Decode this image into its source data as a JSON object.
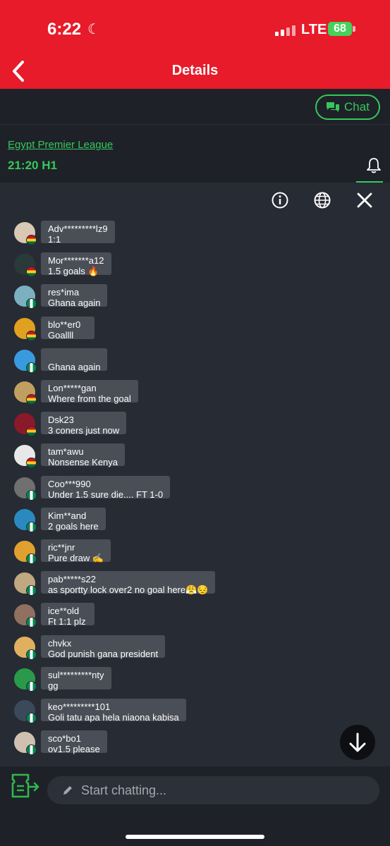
{
  "status": {
    "time": "6:22",
    "carrier": "LTE",
    "battery": "68"
  },
  "header": {
    "title": "Details"
  },
  "chat_button": {
    "label": "Chat"
  },
  "match": {
    "league": "Egypt Premier League",
    "clock": "21:20 H1"
  },
  "messages": [
    {
      "user": "Adv*********lz9",
      "text": "1:1",
      "flag": "ghana",
      "avatar": "#d8c8b4"
    },
    {
      "user": "Mor*******a12",
      "text": "1.5 goals 🔥",
      "flag": "ghana",
      "avatar": "#2a3a3a"
    },
    {
      "user": "res*ima",
      "text": "Ghana again",
      "flag": "nigeria",
      "avatar": "#7ab0c0"
    },
    {
      "user": "blo**er0",
      "text": "Goallll",
      "flag": "ghana",
      "avatar": "#e0a020"
    },
    {
      "user": "",
      "text": "Ghana again",
      "flag": "nigeria",
      "avatar": "#3a9ae0"
    },
    {
      "user": "Lon*****gan",
      "text": "Where from the goal",
      "flag": "ghana",
      "avatar": "#c0a060"
    },
    {
      "user": "Dsk23",
      "text": "3 coners just now",
      "flag": "ghana",
      "avatar": "#8a1a2a"
    },
    {
      "user": "tam*awu",
      "text": "Nonsense Kenya",
      "flag": "ghana",
      "avatar": "#e8e8e8"
    },
    {
      "user": "Coo***990",
      "text": "Under 1.5 sure die.... FT 1-0",
      "flag": "nigeria",
      "avatar": "#707070"
    },
    {
      "user": "Kim**and",
      "text": "2 goals here",
      "flag": "nigeria",
      "avatar": "#2a8ac0"
    },
    {
      "user": "ric**jnr",
      "text": "Pure draw ✍️",
      "flag": "nigeria",
      "avatar": "#e0a030"
    },
    {
      "user": "pab*****s22",
      "text": "as sportty lock over2 no goal here😤😔",
      "flag": "nigeria",
      "avatar": "#c0a880"
    },
    {
      "user": "ice**old",
      "text": "Ft 1:1 plz",
      "flag": "nigeria",
      "avatar": "#907060"
    },
    {
      "user": "chvkx",
      "text": "God punish gana president",
      "flag": "nigeria",
      "avatar": "#e0b060"
    },
    {
      "user": "sul*********nty",
      "text": "gg",
      "flag": "nigeria",
      "avatar": "#2a9a4a"
    },
    {
      "user": "keo*********101",
      "text": "Goli tatu apa hela niaona kabisa",
      "flag": "nigeria",
      "avatar": "#3a4a5a"
    },
    {
      "user": "sco*bo1",
      "text": "ov1.5 please",
      "flag": "nigeria",
      "avatar": "#d0c0b0"
    }
  ],
  "composer": {
    "placeholder": "Start chatting..."
  },
  "colors": {
    "brand_red": "#e71b2a",
    "accent_green": "#36c75c"
  },
  "icons": [
    "back-icon",
    "chat-icon",
    "bell-icon",
    "info-icon",
    "globe-icon",
    "close-icon",
    "arrow-down-icon",
    "ticket-icon",
    "pencil-icon"
  ]
}
